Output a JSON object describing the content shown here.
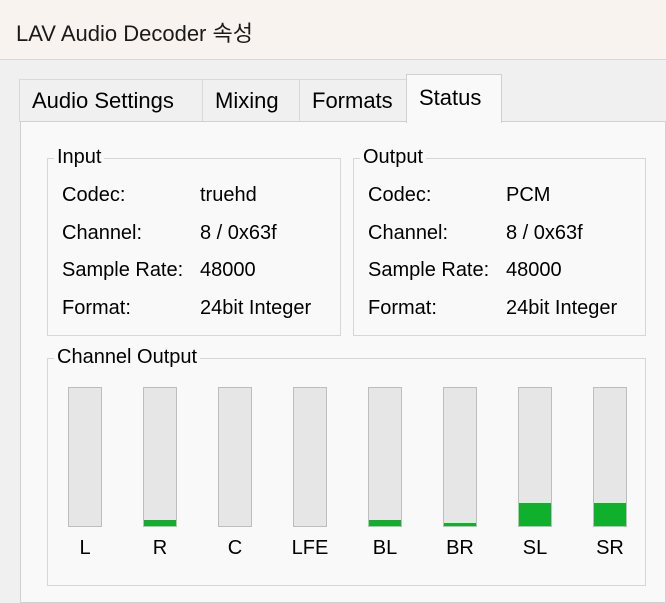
{
  "window": {
    "title": "LAV Audio Decoder 속성"
  },
  "tabs": [
    {
      "label": "Audio Settings"
    },
    {
      "label": "Mixing"
    },
    {
      "label": "Formats"
    },
    {
      "label": "Status",
      "active": true
    }
  ],
  "input": {
    "title": "Input",
    "rows": [
      {
        "label": "Codec:",
        "value": "truehd"
      },
      {
        "label": "Channel:",
        "value": "8 / 0x63f"
      },
      {
        "label": "Sample Rate:",
        "value": "48000"
      },
      {
        "label": "Format:",
        "value": "24bit Integer"
      }
    ]
  },
  "output": {
    "title": "Output",
    "rows": [
      {
        "label": "Codec:",
        "value": "PCM"
      },
      {
        "label": "Channel:",
        "value": "8 / 0x63f"
      },
      {
        "label": "Sample Rate:",
        "value": "48000"
      },
      {
        "label": "Format:",
        "value": "24bit Integer"
      }
    ]
  },
  "channel_output": {
    "title": "Channel Output",
    "meter_color": "#0eb02c",
    "channels": [
      {
        "name": "L",
        "level": 0.0
      },
      {
        "name": "R",
        "level": 0.04
      },
      {
        "name": "C",
        "level": 0.0
      },
      {
        "name": "LFE",
        "level": 0.0
      },
      {
        "name": "BL",
        "level": 0.04
      },
      {
        "name": "BR",
        "level": 0.02
      },
      {
        "name": "SL",
        "level": 0.17
      },
      {
        "name": "SR",
        "level": 0.17
      }
    ]
  }
}
